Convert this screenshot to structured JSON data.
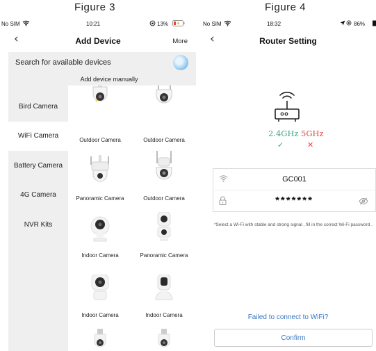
{
  "figures": {
    "left_title": "Figure 3",
    "right_title": "Figure 4"
  },
  "fig3": {
    "status": {
      "carrier": "No SIM",
      "time": "10:21",
      "battery": "13%"
    },
    "nav": {
      "title": "Add Device",
      "more": "More"
    },
    "search": {
      "label": "Search for available devices",
      "manual": "Add device manually"
    },
    "categories": [
      "Bird Camera",
      "WiFi Camera",
      "Battery Camera",
      "4G Camera",
      "NVR Kits"
    ],
    "active_category": "WiFi Camera",
    "devices": [
      {
        "name": "Outdoor Camera",
        "icon": "ptz-outdoor-camera-icon"
      },
      {
        "name": "Outdoor Camera",
        "icon": "ptz-outdoor-camera-icon"
      },
      {
        "name": "Panoramic Camera",
        "icon": "bullet-dual-camera-icon"
      },
      {
        "name": "Outdoor Camera",
        "icon": "bullet-dome-camera-icon"
      },
      {
        "name": "Indoor Camera",
        "icon": "indoor-dome-camera-icon"
      },
      {
        "name": "Panoramic Camera",
        "icon": "dual-lens-indoor-camera-icon"
      },
      {
        "name": "Indoor Camera",
        "icon": "indoor-cube-camera-icon"
      },
      {
        "name": "Indoor Camera",
        "icon": "indoor-robot-camera-icon"
      },
      {
        "name": "",
        "icon": "bulb-camera-icon"
      },
      {
        "name": "",
        "icon": "bulb-camera-icon"
      }
    ]
  },
  "fig4": {
    "status": {
      "carrier": "No SIM",
      "time": "18:32",
      "battery": "86%"
    },
    "nav": {
      "title": "Router Setting"
    },
    "bands": {
      "supported": "2.4GHz",
      "unsupported": "5GHz",
      "supported_mark": "✓",
      "unsupported_mark": "✕",
      "supported_color": "#3aa58a",
      "unsupported_color": "#e04848"
    },
    "wifi_name": "GC001",
    "password_mask": "*******",
    "note": "*Select a Wi-Fi with stable and strong signal , fill in the correct Wi-Fi password .",
    "fail_link": "Failed to connect to WiFi?",
    "confirm": "Confirm",
    "link_color": "#3a78c5"
  }
}
